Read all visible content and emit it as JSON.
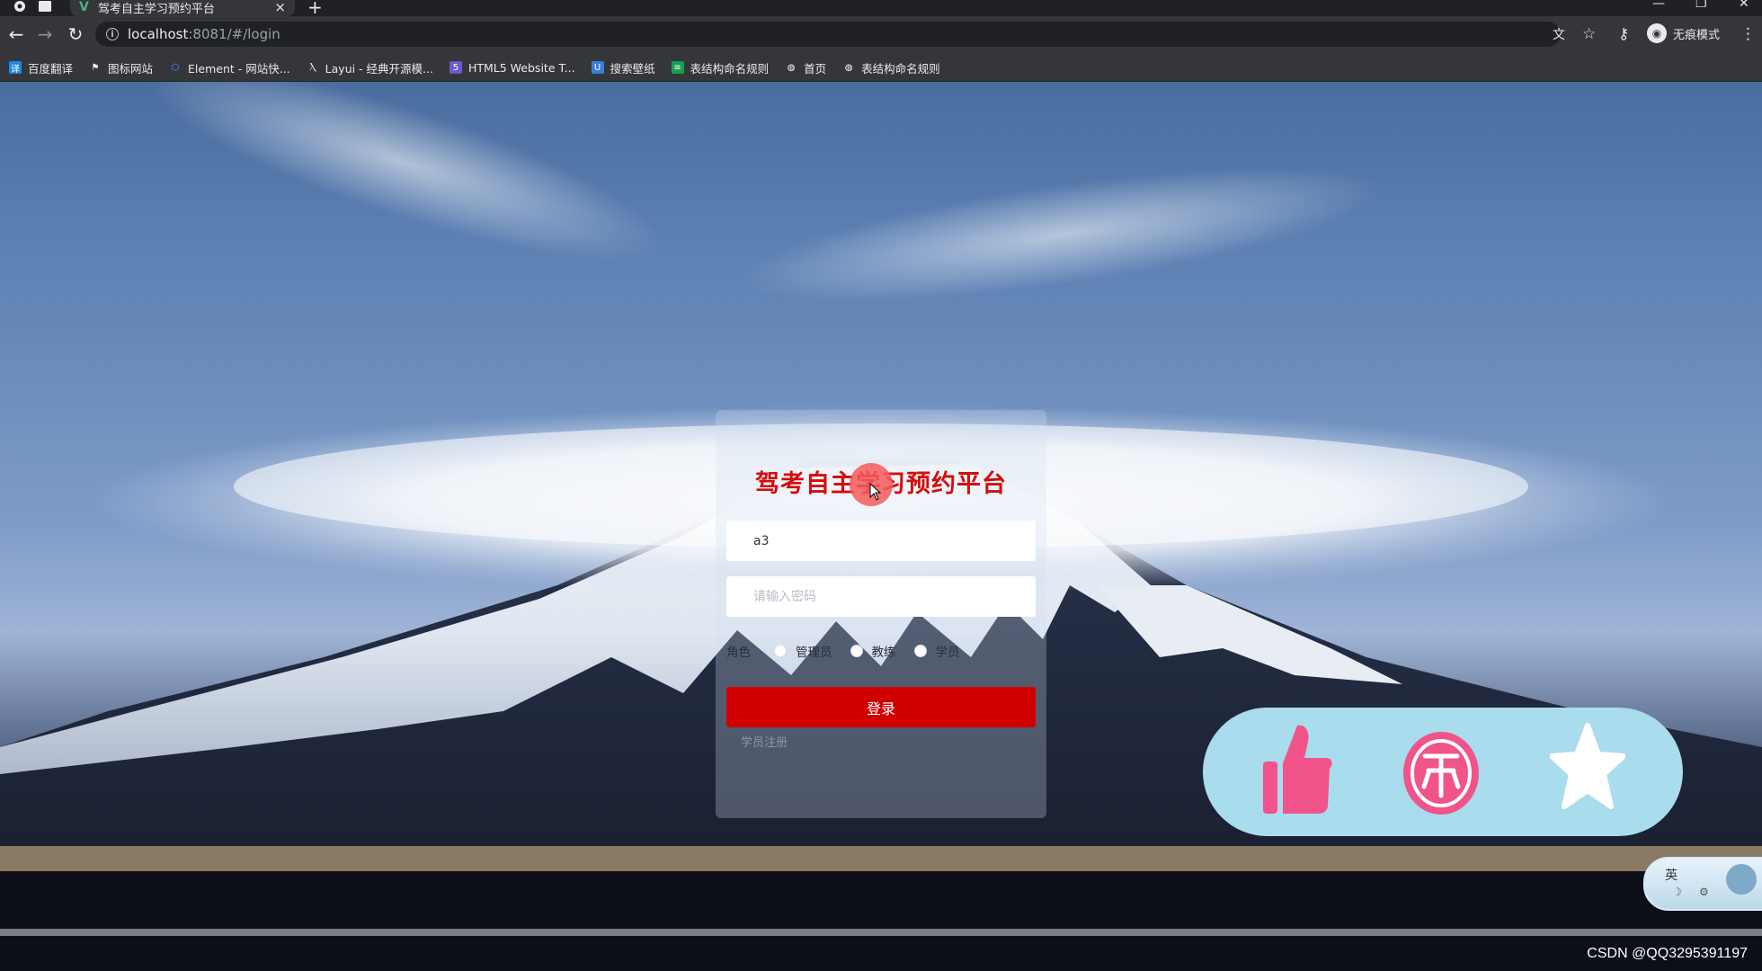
{
  "browser": {
    "tab_title": "驾考自主学习预约平台",
    "url_host": "localhost",
    "url_path": ":8081/#/login",
    "profile_label": "无痕模式",
    "bookmarks": [
      {
        "label": "百度翻译",
        "icon": "translate-icon",
        "color": "#1e88e5"
      },
      {
        "label": "图标网站",
        "icon": "flag-icon",
        "color": "#35363a"
      },
      {
        "label": "Element - 网站快...",
        "icon": "element-icon",
        "color": "#409eff"
      },
      {
        "label": "Layui - 经典开源模...",
        "icon": "layui-icon",
        "color": "#35363a"
      },
      {
        "label": "HTML5 Website T...",
        "icon": "html5-icon",
        "color": "#6a5acd"
      },
      {
        "label": "搜索壁纸",
        "icon": "wallpaper-icon",
        "color": "#3b7dd8"
      },
      {
        "label": "表结构命名规则",
        "icon": "table-icon",
        "color": "#12a150"
      },
      {
        "label": "首页",
        "icon": "globe-icon",
        "color": "#35363a"
      },
      {
        "label": "表结构命名规则",
        "icon": "globe-icon",
        "color": "#35363a"
      }
    ]
  },
  "login": {
    "title": "驾考自主学习预约平台",
    "username_value": "a3",
    "password_placeholder": "请输入密码",
    "role_label": "角色",
    "roles": [
      "管理员",
      "教练",
      "学员"
    ],
    "login_button": "登录",
    "register_link": "学员注册"
  },
  "overlay": {
    "actions": [
      "like-icon",
      "coin-icon",
      "star-icon"
    ],
    "ime_label": "英",
    "watermark": "CSDN @QQ3295391197"
  },
  "colors": {
    "title_red": "#d40d0d",
    "button_red": "#d00000",
    "pill_bg": "#a9dcec",
    "pink": "#f0548a"
  }
}
